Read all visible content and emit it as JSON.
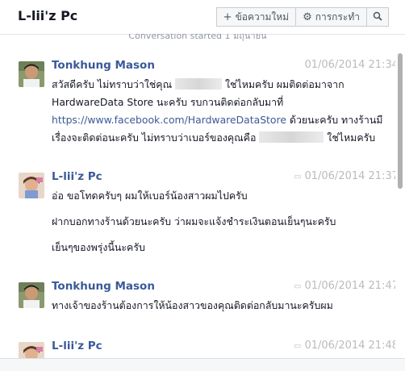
{
  "header": {
    "title": "L-lii'z Pc",
    "new_message_label": "ข้อความใหม่",
    "actions_label": "การกระทำ"
  },
  "conversation_started": "Conversation started 1 มิถุนายน",
  "messages": [
    {
      "name": "Tonkhung Mason",
      "time": "01/06/2014 21:34",
      "parts": [
        "สวัสดีครับ ไม่ทราบว่าใช่คุณ",
        "ใช่ไหมครับ ผมติดต่อมาจาก HardwareData Store นะครับ รบกวนติดต่อกลับมาที่ ",
        "https://www.facebook.com/HardwareDataStore",
        " ด้วยนะครับ ทางร้านมีเรื่องจะติดต่อนะครับ ไม่ทราบว่าเบอร์ของคุณคือ",
        "ใช่ไหมครับ"
      ]
    },
    {
      "name": "L-lii'z Pc",
      "time": "01/06/2014 21:37",
      "paragraphs": [
        "อ่อ ขอโทดครับๆ ผมให้เบอร์น้องสาวผมไปครับ",
        "ฝากบอกทางร้านด้วยนะครับ ว่าผมจะแจ้งชำระเงินตอนเย็นๆนะครับ",
        "เย็นๆของพรุ่งนี้นะครับ"
      ]
    },
    {
      "name": "Tonkhung Mason",
      "time": "01/06/2014 21:47",
      "paragraphs": [
        "ทางเจ้าของร้านต้องการให้น้องสาวของคุณติดต่อกลับมานะครับผม"
      ]
    },
    {
      "name": "L-lii'z Pc",
      "time": "01/06/2014 21:48",
      "paragraphs": []
    }
  ],
  "icons": {
    "plus": "plus-icon",
    "gear": "gear-icon",
    "search": "search-icon",
    "message": "message-icon"
  },
  "colors": {
    "name": "#3b5998",
    "link": "#3b5998",
    "time": "#bbbbbb"
  }
}
